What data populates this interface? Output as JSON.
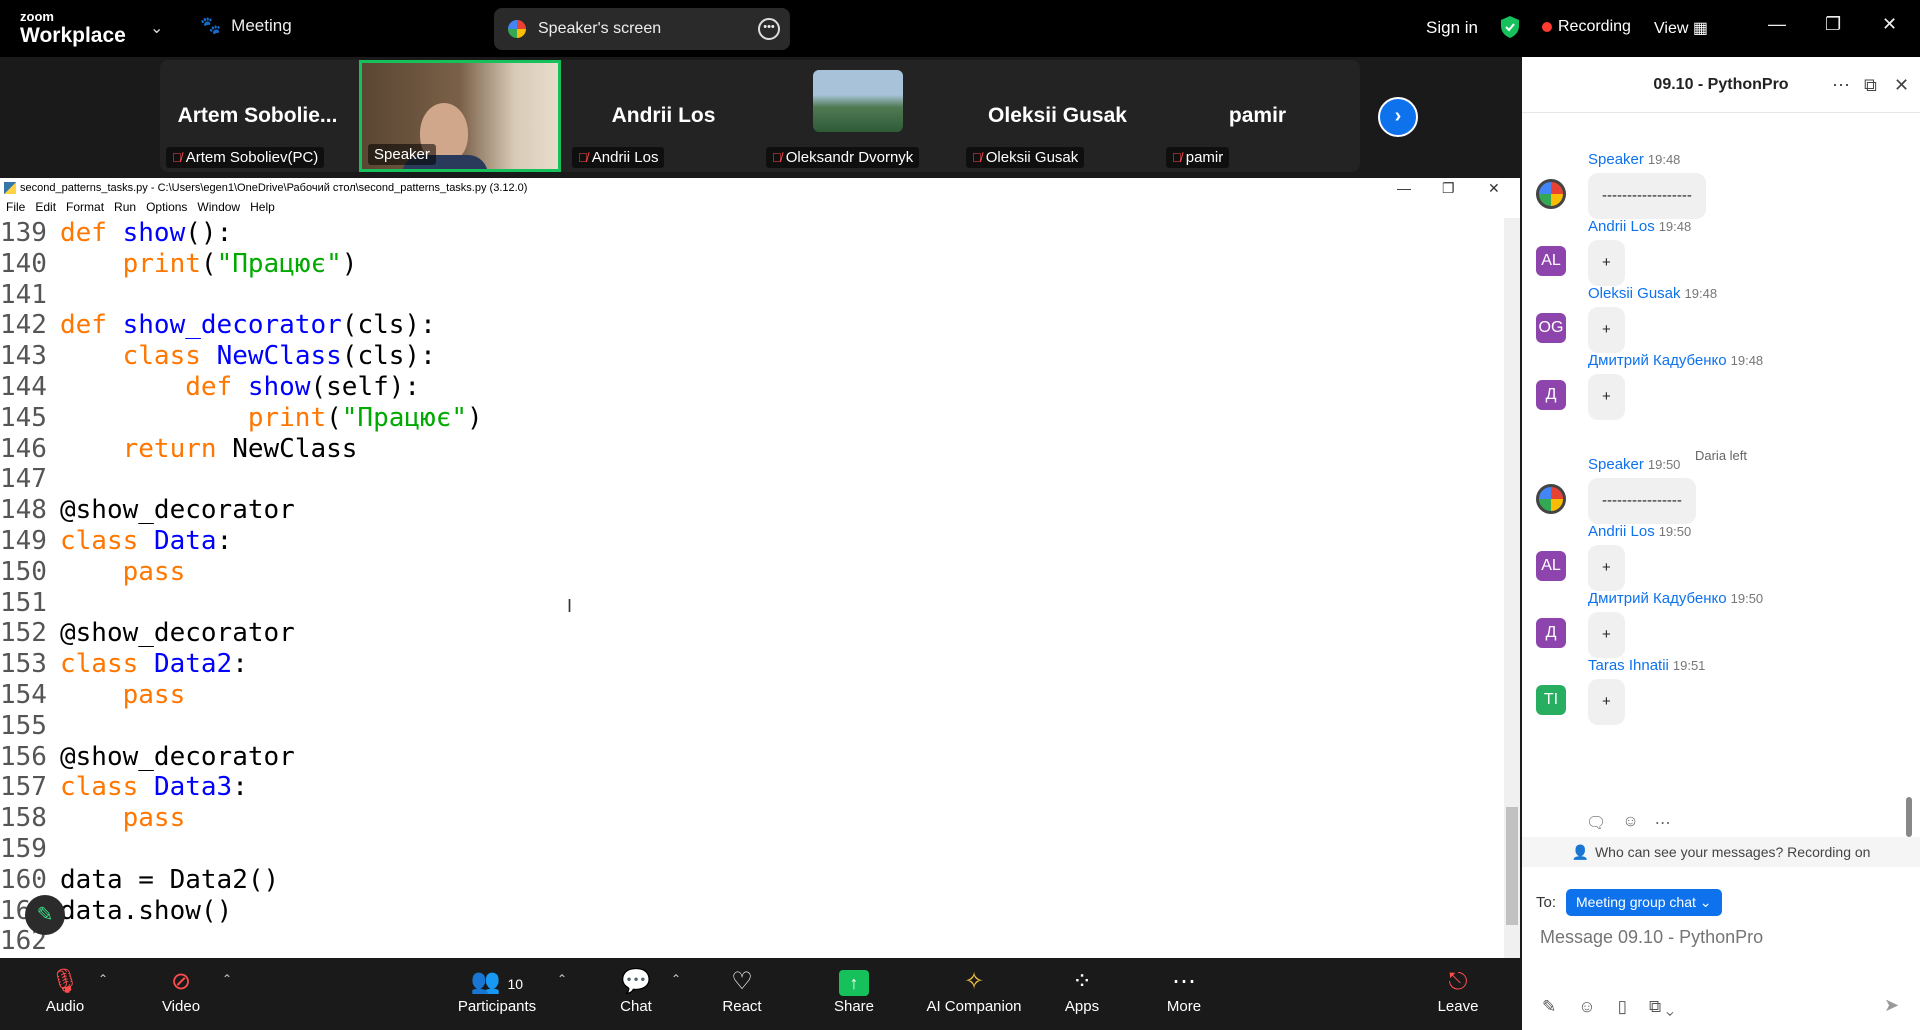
{
  "topbar": {
    "logo_small": "zoom",
    "logo_big": "Workplace",
    "meeting_label": "Meeting",
    "screen_label": "Speaker's screen",
    "signin_label": "Sign in",
    "recording_label": "Recording",
    "view_label": "View"
  },
  "participants_strip": [
    {
      "display": "Artem  Sobolie...",
      "tag": "Artem Soboliev(PC)"
    },
    {
      "display": "",
      "tag": "Speaker"
    },
    {
      "display": "Andrii Los",
      "tag": "Andrii Los"
    },
    {
      "display": "",
      "tag": "Oleksandr Dvornyk"
    },
    {
      "display": "Oleksii Gusak",
      "tag": "Oleksii Gusak"
    },
    {
      "display": "pamir",
      "tag": "pamir"
    }
  ],
  "idle": {
    "title": "second_patterns_tasks.py - C:\\Users\\egen1\\OneDrive\\Рабочий стол\\second_patterns_tasks.py (3.12.0)",
    "menu": [
      "File",
      "Edit",
      "Format",
      "Run",
      "Options",
      "Window",
      "Help"
    ],
    "lines": [
      {
        "n": "139",
        "c": "def show():"
      },
      {
        "n": "140",
        "c": "    print(\"Працює\")"
      },
      {
        "n": "141",
        "c": ""
      },
      {
        "n": "142",
        "c": "def show_decorator(cls):"
      },
      {
        "n": "143",
        "c": "    class NewClass(cls):"
      },
      {
        "n": "144",
        "c": "        def show(self):"
      },
      {
        "n": "145",
        "c": "            print(\"Працює\")"
      },
      {
        "n": "146",
        "c": "    return NewClass"
      },
      {
        "n": "147",
        "c": ""
      },
      {
        "n": "148",
        "c": "@show_decorator"
      },
      {
        "n": "149",
        "c": "class Data:"
      },
      {
        "n": "150",
        "c": "    pass"
      },
      {
        "n": "151",
        "c": ""
      },
      {
        "n": "152",
        "c": "@show_decorator"
      },
      {
        "n": "153",
        "c": "class Data2:"
      },
      {
        "n": "154",
        "c": "    pass"
      },
      {
        "n": "155",
        "c": ""
      },
      {
        "n": "156",
        "c": "@show_decorator"
      },
      {
        "n": "157",
        "c": "class Data3:"
      },
      {
        "n": "158",
        "c": "    pass"
      },
      {
        "n": "159",
        "c": ""
      },
      {
        "n": "160",
        "c": "data = Data2()"
      },
      {
        "n": "161",
        "c": "data.show()"
      },
      {
        "n": "162",
        "c": ""
      }
    ]
  },
  "toolbar": {
    "audio": "Audio",
    "video": "Video",
    "participants": "Participants",
    "participants_count": "10",
    "chat": "Chat",
    "react": "React",
    "share": "Share",
    "ai": "AI Companion",
    "apps": "Apps",
    "more": "More",
    "leave": "Leave"
  },
  "chat": {
    "title": "09.10 - PythonPro",
    "messages": [
      {
        "sender": "Speaker",
        "time": "19:48",
        "text": "------------------",
        "avatar": "",
        "color": "logo"
      },
      {
        "sender": "Andrii Los",
        "time": "19:48",
        "text": "+",
        "avatar": "AL",
        "color": "#8e44ad"
      },
      {
        "sender": "Oleksii Gusak",
        "time": "19:48",
        "text": "+",
        "avatar": "OG",
        "color": "#8e44ad"
      },
      {
        "sender": "Дмитрий Кадубенко",
        "time": "19:48",
        "text": "+",
        "avatar": "Д",
        "color": "#8e44ad"
      },
      {
        "sender": "Speaker",
        "time": "19:50",
        "text": "----------------",
        "avatar": "",
        "color": "logo"
      },
      {
        "sender": "Andrii Los",
        "time": "19:50",
        "text": "+",
        "avatar": "AL",
        "color": "#8e44ad"
      },
      {
        "sender": "Дмитрий Кадубенко",
        "time": "19:50",
        "text": "+",
        "avatar": "Д",
        "color": "#8e44ad"
      },
      {
        "sender": "Taras Ihnatii",
        "time": "19:51",
        "text": "+",
        "avatar": "TI",
        "color": "#27ae60"
      }
    ],
    "system_note": "Daria left",
    "privacy": "Who can see your messages? Recording on",
    "to_label": "To:",
    "to_target": "Meeting group chat",
    "compose_placeholder": "Message 09.10 - PythonPro"
  }
}
